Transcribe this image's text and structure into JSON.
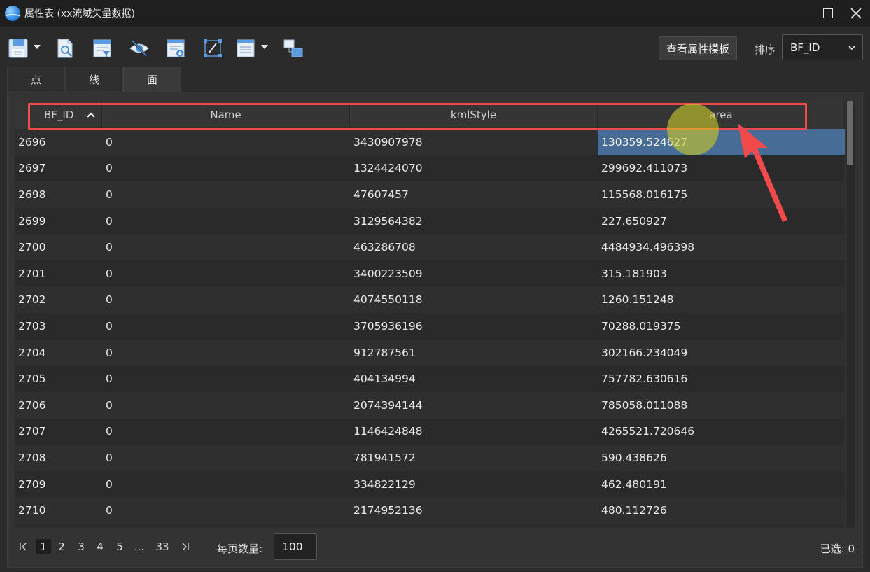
{
  "window": {
    "title": "属性表 (xx流域矢量数据)",
    "icons": [
      "app-logo-icon",
      "maximize-icon",
      "close-icon"
    ]
  },
  "toolbar": {
    "icons": [
      "save-icon",
      "dropdown-caret-icon",
      "search-document-icon",
      "filter-document-icon",
      "hide-eye-icon",
      "export-document-icon",
      "edit-box-icon",
      "list-icon",
      "dropdown-caret-icon",
      "layers-icon"
    ],
    "template_button": "查看属性模板",
    "sort_label": "排序",
    "sort_value": "BF_ID"
  },
  "tabs": [
    {
      "label": "点",
      "active": false
    },
    {
      "label": "线",
      "active": false
    },
    {
      "label": "面",
      "active": true
    }
  ],
  "table": {
    "columns": [
      "BF_ID",
      "Name",
      "kmlStyle",
      "area"
    ],
    "sort_column": "BF_ID",
    "sort_direction": "ascending",
    "rows": [
      [
        "2696",
        "0",
        "3430907978",
        "130359.524627"
      ],
      [
        "2697",
        "0",
        "1324424070",
        "299692.411073"
      ],
      [
        "2698",
        "0",
        "47607457",
        "115568.016175"
      ],
      [
        "2699",
        "0",
        "3129564382",
        "227.650927"
      ],
      [
        "2700",
        "0",
        "463286708",
        "4484934.496398"
      ],
      [
        "2701",
        "0",
        "3400223509",
        "315.181903"
      ],
      [
        "2702",
        "0",
        "4074550118",
        "1260.151248"
      ],
      [
        "2703",
        "0",
        "3705936196",
        "70288.019375"
      ],
      [
        "2704",
        "0",
        "912787561",
        "302166.234049"
      ],
      [
        "2705",
        "0",
        "404134994",
        "757782.630616"
      ],
      [
        "2706",
        "0",
        "2074394144",
        "785058.011088"
      ],
      [
        "2707",
        "0",
        "1146424848",
        "4265521.720646"
      ],
      [
        "2708",
        "0",
        "781941572",
        "590.438626"
      ],
      [
        "2709",
        "0",
        "334822129",
        "462.480191"
      ],
      [
        "2710",
        "0",
        "2174952136",
        "480.112726"
      ]
    ],
    "selected_cell": {
      "row": 0,
      "column": 3
    }
  },
  "pagination": {
    "pages": [
      "1",
      "2",
      "3",
      "4",
      "5",
      "...",
      "33"
    ],
    "current": "1",
    "per_page_label": "每页数量:",
    "per_page_value": "100",
    "selected_count": "已选: 0"
  },
  "colors": {
    "highlight": "#ef4b4b",
    "selection": "#476c96",
    "cursor": "#c8c828"
  }
}
